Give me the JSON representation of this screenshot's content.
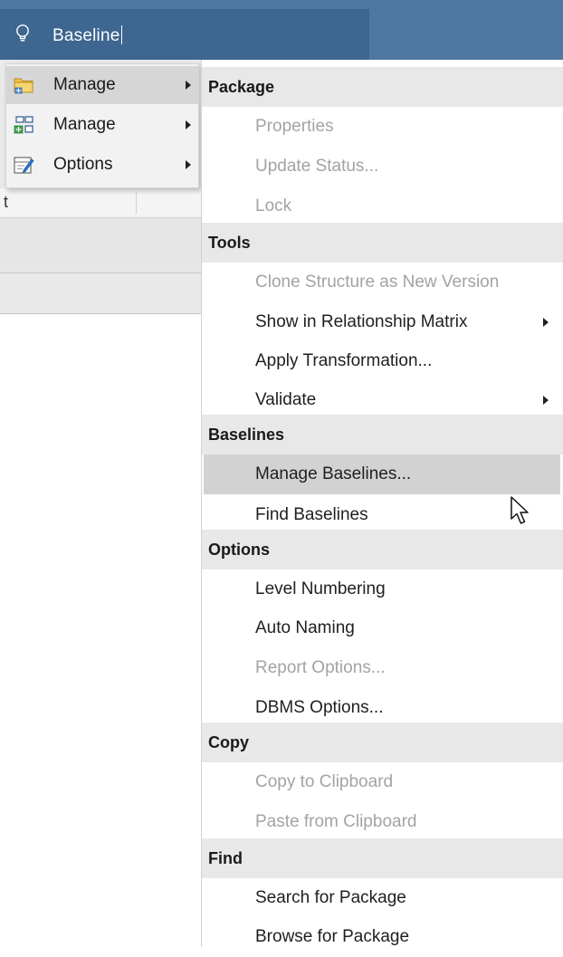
{
  "search": {
    "icon": "lightbulb-icon",
    "query": "Baseline"
  },
  "background": {
    "column_header": "t"
  },
  "left_menu": {
    "items": [
      {
        "label": "Manage",
        "icon": "package-folder-icon",
        "has_submenu": true,
        "selected": true
      },
      {
        "label": "Manage",
        "icon": "element-structure-icon",
        "has_submenu": true,
        "selected": false
      },
      {
        "label": "Options",
        "icon": "options-edit-icon",
        "has_submenu": true,
        "selected": false
      }
    ]
  },
  "menu": {
    "sections": [
      {
        "header": "Package",
        "items": [
          {
            "label": "Properties",
            "enabled": false
          },
          {
            "label": "Update Status...",
            "enabled": false
          },
          {
            "label": "Lock",
            "enabled": false
          }
        ]
      },
      {
        "header": "Tools",
        "items": [
          {
            "label": "Clone Structure as New Version",
            "enabled": false
          },
          {
            "label": "Show in Relationship Matrix",
            "enabled": true,
            "has_submenu": true
          },
          {
            "label": "Apply Transformation...",
            "enabled": true
          },
          {
            "label": "Validate",
            "enabled": true,
            "has_submenu": true
          }
        ]
      },
      {
        "header": "Baselines",
        "items": [
          {
            "label": "Manage Baselines...",
            "enabled": true,
            "hovered": true
          },
          {
            "label": "Find Baselines",
            "enabled": true
          }
        ]
      },
      {
        "header": "Options",
        "items": [
          {
            "label": "Level Numbering",
            "enabled": true
          },
          {
            "label": "Auto Naming",
            "enabled": true
          },
          {
            "label": "Report Options...",
            "enabled": false
          },
          {
            "label": "DBMS Options...",
            "enabled": true
          }
        ]
      },
      {
        "header": "Copy",
        "items": [
          {
            "label": "Copy to Clipboard",
            "enabled": false
          },
          {
            "label": "Paste from Clipboard",
            "enabled": false
          }
        ]
      },
      {
        "header": "Find",
        "items": [
          {
            "label": "Search for Package",
            "enabled": true
          },
          {
            "label": "Browse for Package",
            "enabled": true
          }
        ]
      }
    ]
  },
  "colors": {
    "title_bar": "#4e78a3",
    "search_box": "#3d6690",
    "section_header_bg": "#e8e8e8",
    "hover_bg": "#d2d2d2",
    "disabled_text": "#a3a3a3"
  }
}
